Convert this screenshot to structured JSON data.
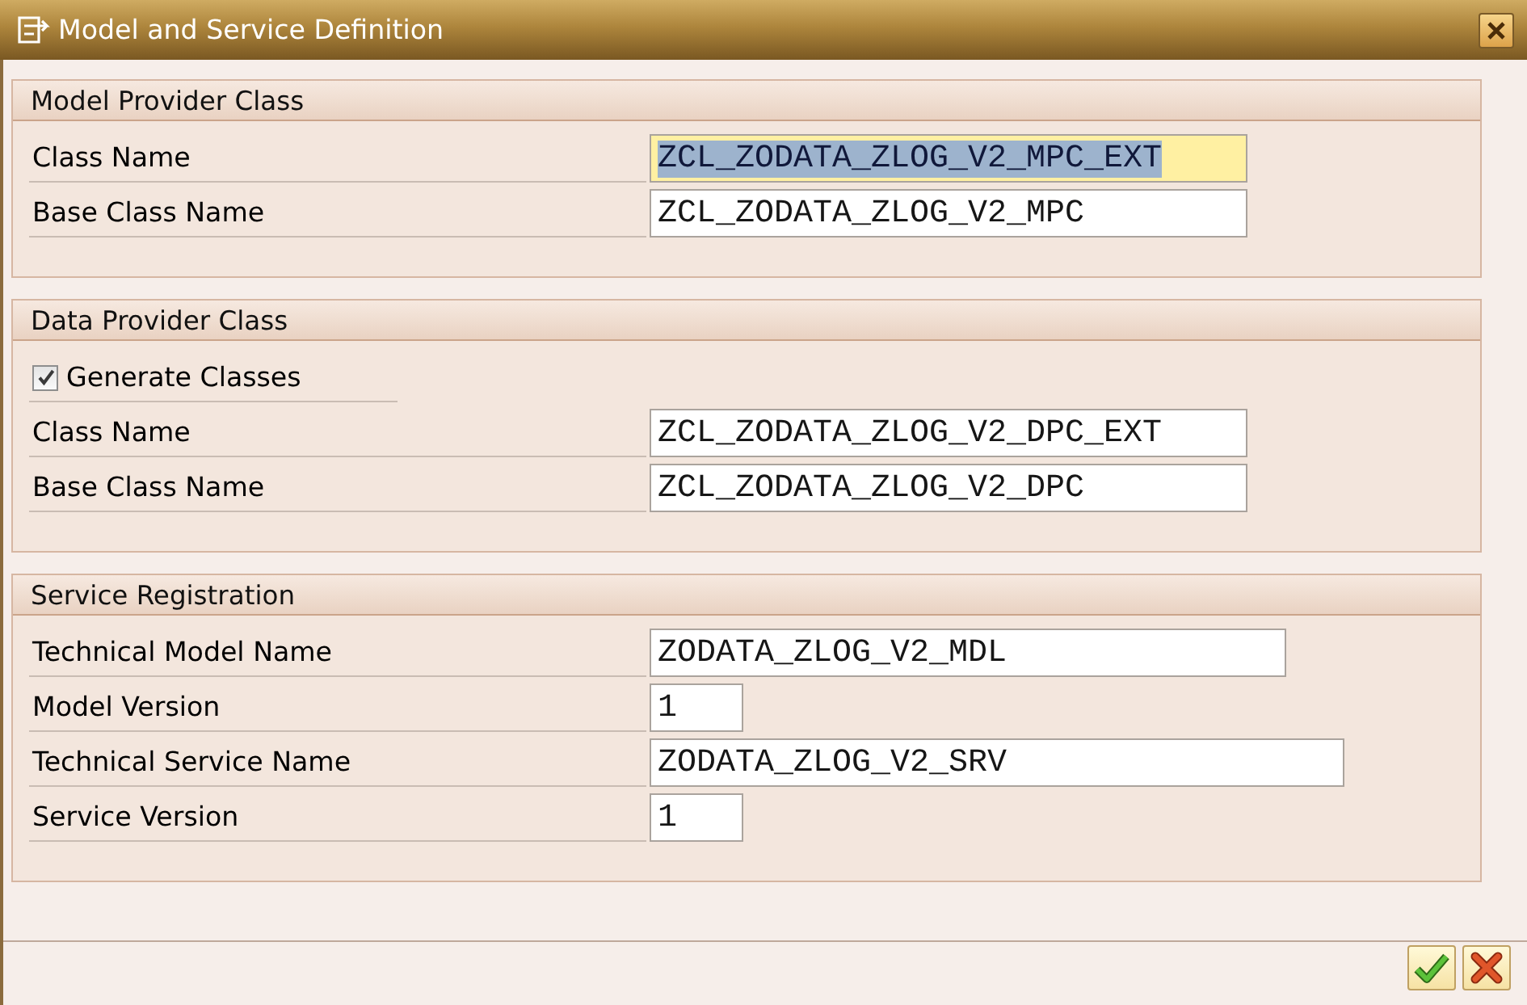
{
  "window": {
    "title": "Model and Service Definition"
  },
  "groups": [
    {
      "title": "Model Provider Class",
      "rows": [
        {
          "kind": "field",
          "label": "Class Name",
          "value": "ZCL_ZODATA_ZLOG_V2_MPC_EXT",
          "focused": true,
          "text_selected": true
        },
        {
          "kind": "field",
          "label": "Base Class Name",
          "value": "ZCL_ZODATA_ZLOG_V2_MPC",
          "focused": false,
          "text_selected": false
        }
      ]
    },
    {
      "title": "Data Provider Class",
      "rows": [
        {
          "kind": "checkbox",
          "label": "Generate Classes",
          "checked": true
        },
        {
          "kind": "field",
          "label": "Class Name",
          "value": "ZCL_ZODATA_ZLOG_V2_DPC_EXT",
          "focused": false,
          "text_selected": false
        },
        {
          "kind": "field",
          "label": "Base Class Name",
          "value": "ZCL_ZODATA_ZLOG_V2_DPC",
          "focused": false,
          "text_selected": false
        }
      ]
    },
    {
      "title": "Service Registration",
      "rows": [
        {
          "kind": "field",
          "label": "Technical Model Name",
          "value": "ZODATA_ZLOG_V2_MDL",
          "focused": false,
          "text_selected": false
        },
        {
          "kind": "field",
          "label": "Model Version",
          "value": "1",
          "focused": false,
          "text_selected": false
        },
        {
          "kind": "field",
          "label": "Technical Service Name",
          "value": "ZODATA_ZLOG_V2_SRV",
          "focused": false,
          "text_selected": false
        },
        {
          "kind": "field",
          "label": "Service Version",
          "value": "1",
          "focused": false,
          "text_selected": false
        }
      ]
    }
  ],
  "buttons": [
    {
      "kind": "confirm"
    },
    {
      "kind": "cancel"
    }
  ]
}
